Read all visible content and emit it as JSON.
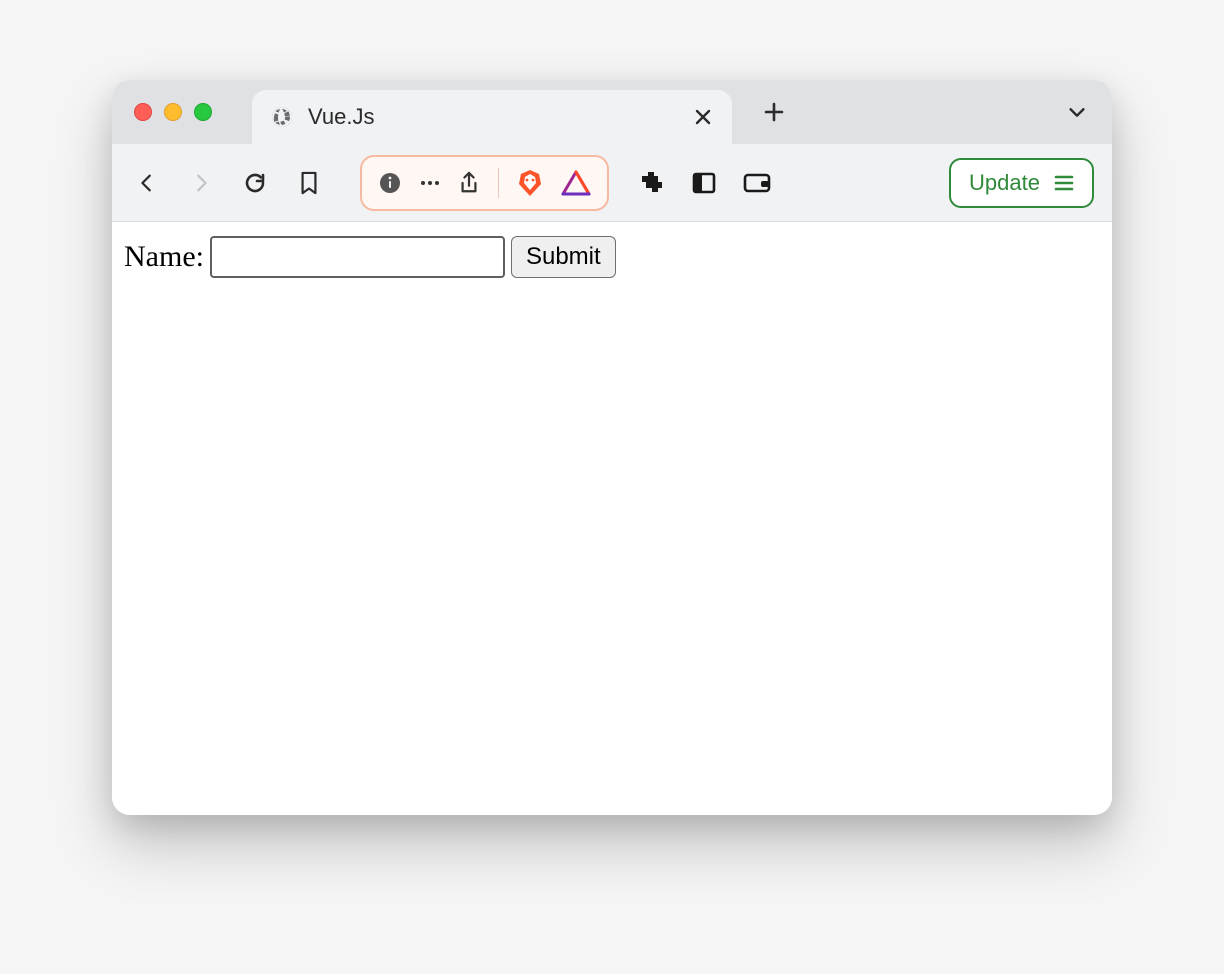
{
  "window": {
    "tab_title": "Vue.Js"
  },
  "toolbar": {
    "update_label": "Update"
  },
  "page": {
    "name_label": "Name:",
    "name_value": "",
    "submit_label": "Submit"
  }
}
